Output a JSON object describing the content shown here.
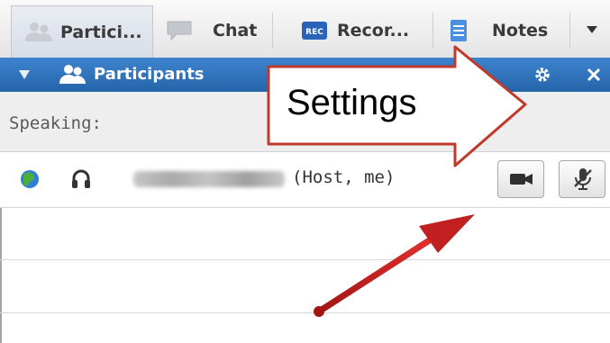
{
  "tabs": [
    {
      "label": "Partici...",
      "icon": "participants-icon",
      "active": true
    },
    {
      "label": "Chat",
      "icon": "chat-icon",
      "active": false
    },
    {
      "label": "Recor...",
      "icon": "recorder-icon",
      "icon_text": "REC",
      "active": false
    },
    {
      "label": "Notes",
      "icon": "notes-icon",
      "active": false
    }
  ],
  "tab_overflow_icon": "dropdown-arrow-icon",
  "panel": {
    "title": "Participants",
    "collapse_icon": "collapse-triangle-icon",
    "settings_icon": "gear-icon",
    "close_icon": "close-icon"
  },
  "speaking_label": "Speaking:",
  "participants": [
    {
      "name": "(redacted)",
      "role": "(Host, me)",
      "status_icon": "globe-icon",
      "audio_icon": "headset-icon",
      "video_button_icon": "video-camera-icon",
      "mute_button_icon": "microphone-muted-icon"
    }
  ],
  "callout": {
    "text": "Settings",
    "fill": "#ffffff",
    "border": "#c0392b",
    "pointer_arrow_color": "#c0201f"
  },
  "colors": {
    "titlebar": "#2f73bc",
    "tab_active": "#dfe4eb",
    "background": "#eeeeee"
  }
}
